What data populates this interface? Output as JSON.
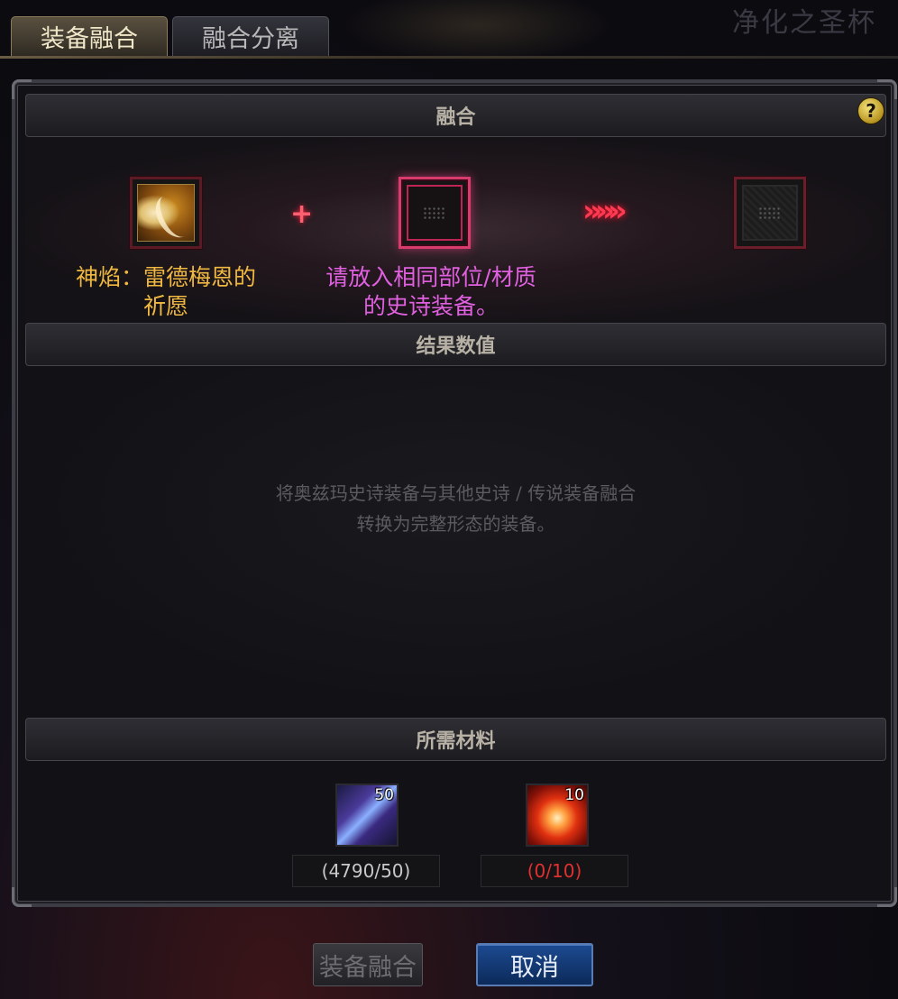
{
  "background": {
    "title": "净化之圣杯"
  },
  "tabs": [
    {
      "label": "装备融合",
      "active": true
    },
    {
      "label": "融合分离",
      "active": false
    }
  ],
  "panel": {
    "fusion_header": "融合",
    "help_label": "?",
    "fusion": {
      "plus_symbol": "+",
      "arrow_symbol": "»»»",
      "item_name_line1": "神焰：雷德梅恩的",
      "item_name_line2": "祈愿",
      "place_hint_line1": "请放入相同部位/材质",
      "place_hint_line2": "的史诗装备。"
    },
    "result_header": "结果数值",
    "result_desc_line1": "将奥兹玛史诗装备与其他史诗 / 传说装备融合",
    "result_desc_line2": "转换为完整形态的装备。",
    "materials_header": "所需材料",
    "materials": [
      {
        "count": "50",
        "quantity": "(4790/50)",
        "icon": "crystal-material-icon",
        "status_color": "#c8c8c8"
      },
      {
        "count": "10",
        "quantity": "(0/10)",
        "icon": "fire-orb-material-icon",
        "status_color": "#e03030"
      }
    ]
  },
  "buttons": {
    "fuse": "装备融合",
    "cancel": "取消"
  },
  "colors": {
    "item_name": "#f0b840",
    "place_hint": "#e060e0",
    "accent_red": "#ff3a50",
    "cancel_button": "#1c4a90"
  }
}
